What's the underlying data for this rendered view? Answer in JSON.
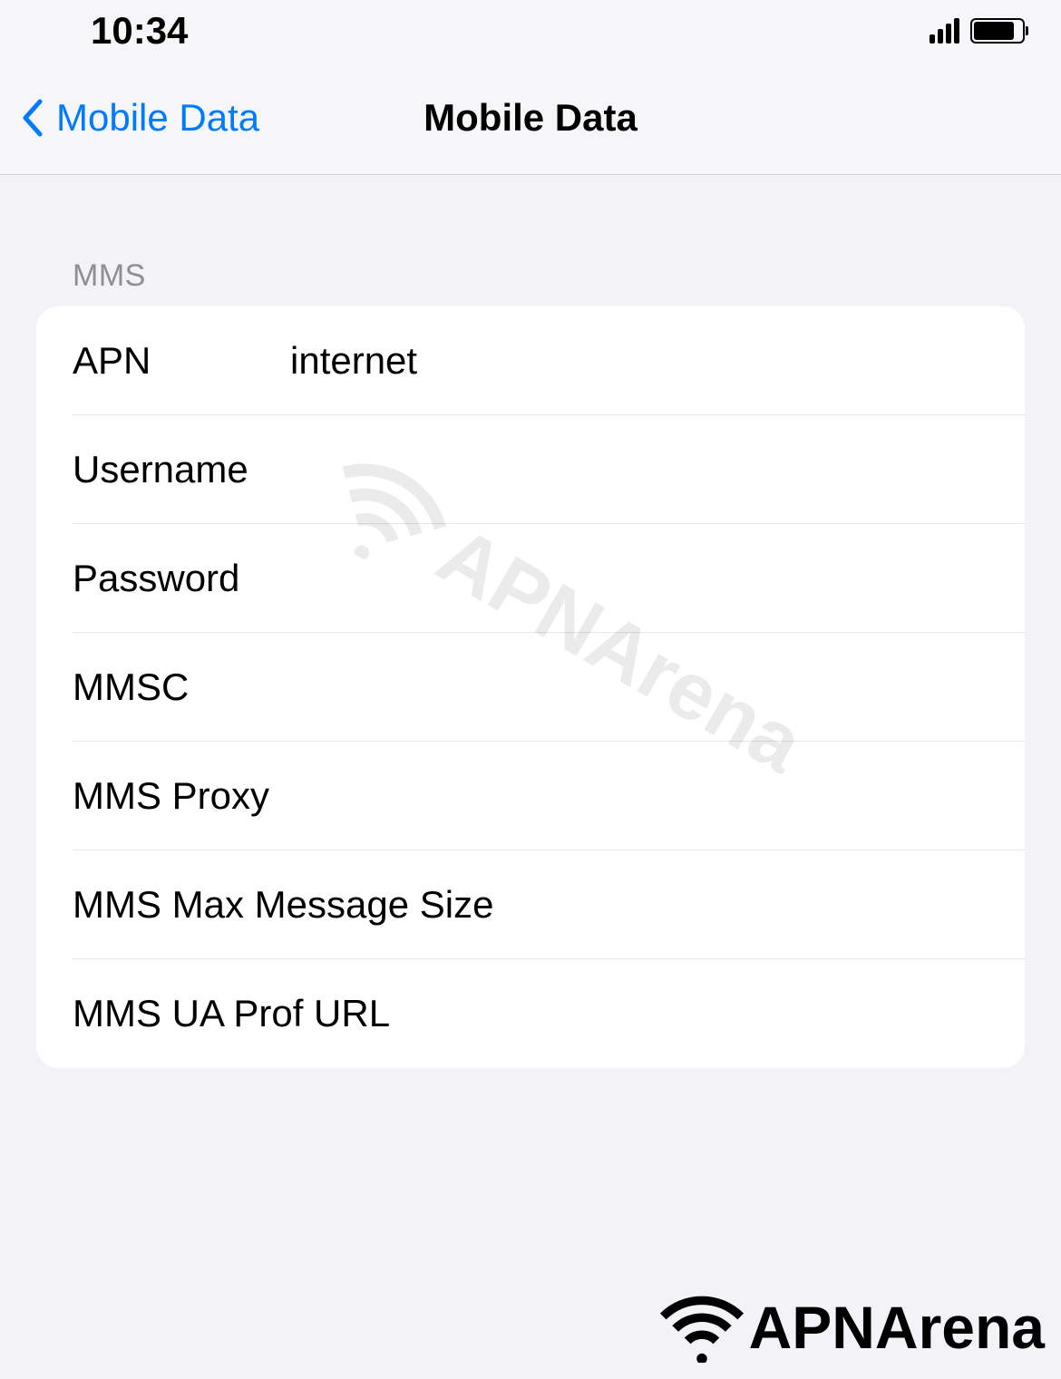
{
  "statusBar": {
    "time": "10:34"
  },
  "nav": {
    "back": "Mobile Data",
    "title": "Mobile Data"
  },
  "section": {
    "header": "MMS",
    "rows": [
      {
        "label": "APN",
        "value": "internet"
      },
      {
        "label": "Username",
        "value": ""
      },
      {
        "label": "Password",
        "value": ""
      },
      {
        "label": "MMSC",
        "value": ""
      },
      {
        "label": "MMS Proxy",
        "value": ""
      },
      {
        "label": "MMS Max Message Size",
        "value": ""
      },
      {
        "label": "MMS UA Prof URL",
        "value": ""
      }
    ]
  },
  "watermark": {
    "text": "APNArena"
  }
}
